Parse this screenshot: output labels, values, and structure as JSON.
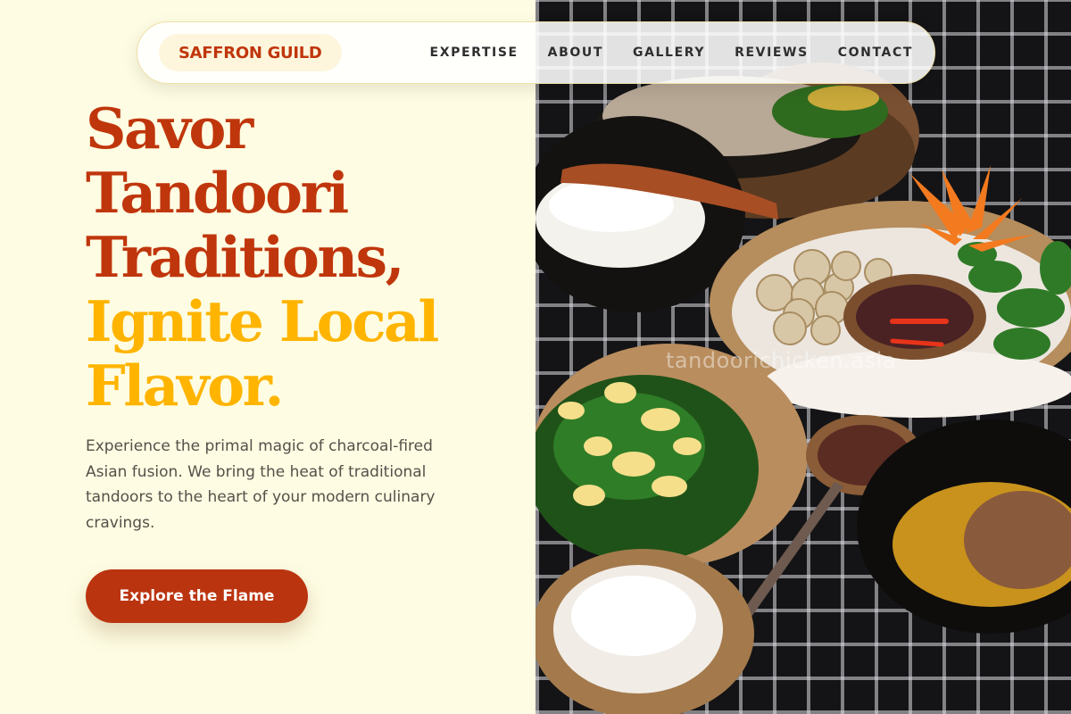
{
  "nav": {
    "brand": "SAFFRON GUILD",
    "links": [
      "EXPERTISE",
      "ABOUT",
      "GALLERY",
      "REVIEWS",
      "CONTACT"
    ]
  },
  "hero": {
    "headline_lines": [
      "Savor",
      "Tandoori",
      "Traditions,",
      "Ignite Local",
      "Flavor."
    ],
    "headline_colors": {
      "primary": "#c0360c",
      "accent": "#ffb400"
    },
    "description": "Experience the primal magic of charcoal-fired Asian fusion. We bring the heat of traditional tandoors to the heart of your modern culinary cravings.",
    "cta_label": "Explore the Flame"
  },
  "photo": {
    "watermark": "tandoorichicken.asia"
  },
  "colors": {
    "background": "#fefde3",
    "brand": "#c0360c",
    "accent": "#ffb400",
    "button": "#bb3410"
  }
}
